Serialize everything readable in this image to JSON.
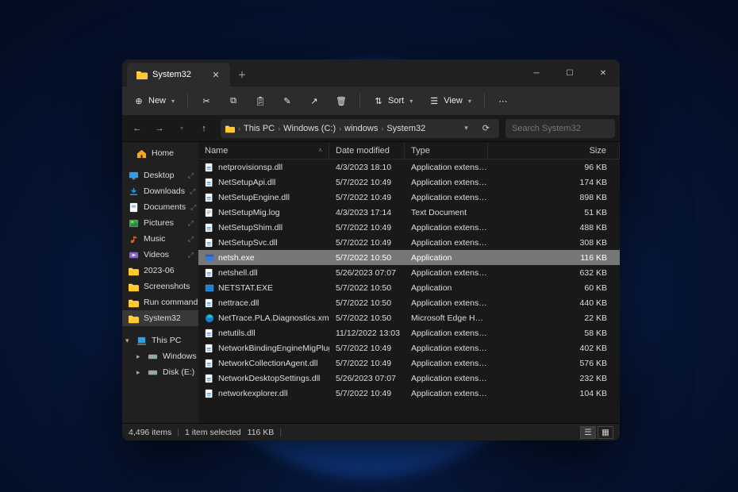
{
  "tab": {
    "title": "System32"
  },
  "toolbar": {
    "new": "New",
    "sort": "Sort",
    "view": "View"
  },
  "breadcrumbs": [
    "This PC",
    "Windows (C:)",
    "windows",
    "System32"
  ],
  "search": {
    "placeholder": "Search System32"
  },
  "sidebar": {
    "home": "Home",
    "quick": [
      {
        "label": "Desktop"
      },
      {
        "label": "Downloads"
      },
      {
        "label": "Documents"
      },
      {
        "label": "Pictures"
      },
      {
        "label": "Music"
      },
      {
        "label": "Videos"
      },
      {
        "label": "2023-06"
      },
      {
        "label": "Screenshots"
      },
      {
        "label": "Run command"
      },
      {
        "label": "System32"
      }
    ],
    "thispc": {
      "label": "This PC",
      "drives": [
        "Windows (C:)",
        "Disk (E:)"
      ]
    }
  },
  "columns": {
    "name": "Name",
    "date": "Date modified",
    "type": "Type",
    "size": "Size"
  },
  "files": [
    {
      "name": "netprovisionsp.dll",
      "date": "4/3/2023 18:10",
      "type": "Application extension",
      "size": "96 KB",
      "icon": "dll"
    },
    {
      "name": "NetSetupApi.dll",
      "date": "5/7/2022 10:49",
      "type": "Application extension",
      "size": "174 KB",
      "icon": "dll"
    },
    {
      "name": "NetSetupEngine.dll",
      "date": "5/7/2022 10:49",
      "type": "Application extension",
      "size": "898 KB",
      "icon": "dll"
    },
    {
      "name": "NetSetupMig.log",
      "date": "4/3/2023 17:14",
      "type": "Text Document",
      "size": "51 KB",
      "icon": "txt"
    },
    {
      "name": "NetSetupShim.dll",
      "date": "5/7/2022 10:49",
      "type": "Application extension",
      "size": "488 KB",
      "icon": "dll"
    },
    {
      "name": "NetSetupSvc.dll",
      "date": "5/7/2022 10:49",
      "type": "Application extension",
      "size": "308 KB",
      "icon": "dll"
    },
    {
      "name": "netsh.exe",
      "date": "5/7/2022 10:50",
      "type": "Application",
      "size": "116 KB",
      "icon": "exe",
      "selected": true
    },
    {
      "name": "netshell.dll",
      "date": "5/26/2023 07:07",
      "type": "Application extension",
      "size": "632 KB",
      "icon": "dll"
    },
    {
      "name": "NETSTAT.EXE",
      "date": "5/7/2022 10:50",
      "type": "Application",
      "size": "60 KB",
      "icon": "exe2"
    },
    {
      "name": "nettrace.dll",
      "date": "5/7/2022 10:50",
      "type": "Application extension",
      "size": "440 KB",
      "icon": "dll"
    },
    {
      "name": "NetTrace.PLA.Diagnostics.xml",
      "date": "5/7/2022 10:50",
      "type": "Microsoft Edge HTML D...",
      "size": "22 KB",
      "icon": "edge"
    },
    {
      "name": "netutils.dll",
      "date": "11/12/2022 13:03",
      "type": "Application extension",
      "size": "58 KB",
      "icon": "dll"
    },
    {
      "name": "NetworkBindingEngineMigPlugin.dll",
      "date": "5/7/2022 10:49",
      "type": "Application extension",
      "size": "402 KB",
      "icon": "dll"
    },
    {
      "name": "NetworkCollectionAgent.dll",
      "date": "5/7/2022 10:49",
      "type": "Application extension",
      "size": "576 KB",
      "icon": "dll"
    },
    {
      "name": "NetworkDesktopSettings.dll",
      "date": "5/26/2023 07:07",
      "type": "Application extension",
      "size": "232 KB",
      "icon": "dll"
    },
    {
      "name": "networkexplorer.dll",
      "date": "5/7/2022 10:49",
      "type": "Application extension",
      "size": "104 KB",
      "icon": "dll"
    }
  ],
  "status": {
    "count": "4,496 items",
    "selected": "1 item selected",
    "size": "116 KB"
  }
}
